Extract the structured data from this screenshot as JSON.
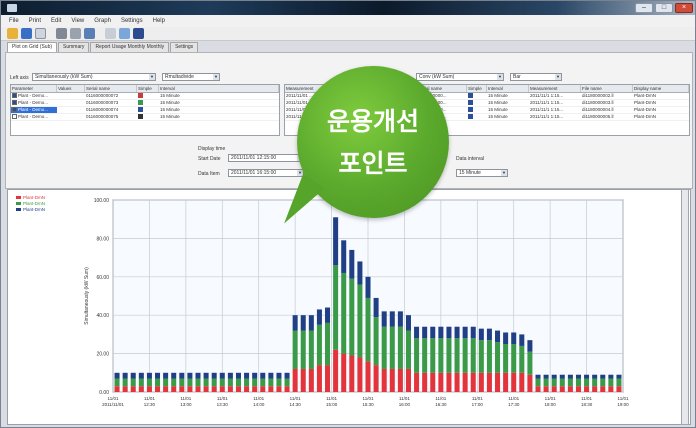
{
  "window": {
    "title": ""
  },
  "menu": {
    "items": [
      "File",
      "Print",
      "Edit",
      "View",
      "Graph",
      "Settings",
      "Help"
    ]
  },
  "tabs": [
    "Plot on Grid (Sub)",
    "Summary",
    "Report Usage Monthly Monthly",
    "Settings"
  ],
  "controls": {
    "left_label": "Left axis",
    "left_value": "Simultaneously (kW Sum)",
    "left_mode": "Rmultadivide",
    "right_label": "",
    "right_value": "Conv (kW Sum)",
    "right_mode": "Bar",
    "display_time_label": "Display time",
    "start_label": "Start Date",
    "start_value": "2011/11/01 12:15:00",
    "end_label": "Data Item",
    "end_value": "2011/11/01 16:15:00",
    "interval_label": "Data interval",
    "interval_value": "15 Minute"
  },
  "left_grid": {
    "headers": [
      "Parameter",
      "Values",
      "Serial name",
      "Simple",
      "Interval"
    ],
    "rows": [
      {
        "name": "Plant - Demo...",
        "serial": "0116000000072",
        "interval": "15 Minute",
        "color": "#c63b3b",
        "checked": true,
        "selected": false
      },
      {
        "name": "Plant - Demo...",
        "serial": "0116000000073",
        "interval": "15 Minute",
        "color": "#3a9a4a",
        "checked": true,
        "selected": false
      },
      {
        "name": "Plant - Demo...",
        "serial": "0116000000074",
        "interval": "15 Minute",
        "color": "#2c4f9a",
        "checked": true,
        "selected": true
      },
      {
        "name": "Plant - Demo...",
        "serial": "0116000000075",
        "interval": "15 Minute",
        "color": "#333333",
        "checked": false,
        "selected": false
      }
    ]
  },
  "mid_grid": {
    "headers": [
      "Measurement"
    ],
    "rows": [
      "2011/11/01 ...",
      "2011/11/01 ...",
      "2011/11/01 ...",
      "2011/11/01 ..."
    ]
  },
  "right_grid": {
    "headers": [
      "Serial name",
      "Simple",
      "Interval",
      "Measurement",
      "File name",
      "Display name"
    ],
    "rows": [
      {
        "serial": "0116000000...",
        "interval": "15 Minute",
        "meas": "2011/11/1 1:15...",
        "file": "di1180000002.ll",
        "display": "Plant-DmN",
        "color": "#2c4f9a"
      },
      {
        "serial": "0116000000...",
        "interval": "15 Minute",
        "meas": "2011/11/1 1:15...",
        "file": "di1180000003.ll",
        "display": "Plant-DmN",
        "color": "#2c4f9a"
      },
      {
        "serial": "0116000000...",
        "interval": "15 Minute",
        "meas": "2011/11/1 1:15...",
        "file": "di1180000004.ll",
        "display": "Plant-DmN",
        "color": "#2c4f9a"
      },
      {
        "serial": "0116000000...",
        "interval": "15 Minute",
        "meas": "2011/11/1 1:15...",
        "file": "di1180000005.ll",
        "display": "Plant-DmN",
        "color": "#2c4f9a"
      }
    ]
  },
  "callout": {
    "line1": "운용개선",
    "line2": "포인트"
  },
  "chart_data": {
    "type": "bar",
    "stacked": true,
    "ylabel": "Simultaneously (kW Sum)",
    "xlabel": "",
    "ylim": [
      0,
      100
    ],
    "yticks": [
      "0.00",
      "20.00",
      "40.00",
      "60.00",
      "80.00",
      "100.00"
    ],
    "xticks": [
      "11/01 2011/11/01",
      "11/01 12:30",
      "11/01 13:00",
      "11/01 13:30",
      "11/01 14:00",
      "11/01 14:30",
      "11/01 15:00",
      "11/01 15:30",
      "11/01 16:00",
      "11/01 16:30",
      "11/01 17:00",
      "11/01 17:30",
      "11/01 18:00",
      "11/01 18:30",
      "11/01 19:00"
    ],
    "legend": [
      "Plant-DmN",
      "Plant-DmN",
      "Plant-DmN"
    ],
    "grid": true,
    "series": [
      {
        "color": "#e2343a",
        "values": [
          3,
          3,
          3,
          3,
          3,
          3,
          3,
          3,
          3,
          3,
          3,
          3,
          3,
          3,
          3,
          3,
          3,
          3,
          3,
          3,
          3,
          3,
          12,
          12,
          12,
          14,
          14,
          22,
          20,
          19,
          18,
          16,
          14,
          12,
          12,
          12,
          12,
          10,
          10,
          10,
          10,
          10,
          10,
          10,
          10,
          10,
          10,
          10,
          10,
          10,
          10,
          9,
          3,
          3,
          3,
          3,
          3,
          3,
          3,
          3,
          3,
          3,
          3
        ]
      },
      {
        "color": "#3a9a48",
        "values": [
          4,
          4,
          4,
          4,
          4,
          4,
          4,
          4,
          4,
          4,
          4,
          4,
          4,
          4,
          4,
          4,
          4,
          4,
          4,
          4,
          4,
          4,
          20,
          20,
          20,
          21,
          22,
          44,
          42,
          40,
          38,
          33,
          25,
          22,
          22,
          22,
          20,
          18,
          18,
          18,
          18,
          18,
          18,
          18,
          18,
          17,
          17,
          16,
          15,
          15,
          14,
          12,
          4,
          4,
          4,
          4,
          4,
          4,
          4,
          4,
          4,
          4,
          4
        ]
      },
      {
        "color": "#203f85",
        "values": [
          3,
          3,
          3,
          3,
          3,
          3,
          3,
          3,
          3,
          3,
          3,
          3,
          3,
          3,
          3,
          3,
          3,
          3,
          3,
          3,
          3,
          3,
          8,
          8,
          8,
          8,
          8,
          25,
          17,
          15,
          12,
          11,
          10,
          8,
          8,
          8,
          8,
          6,
          6,
          6,
          6,
          6,
          6,
          6,
          6,
          6,
          6,
          6,
          6,
          6,
          6,
          6,
          2,
          2,
          2,
          2,
          2,
          2,
          2,
          2,
          2,
          2,
          2
        ]
      }
    ]
  }
}
